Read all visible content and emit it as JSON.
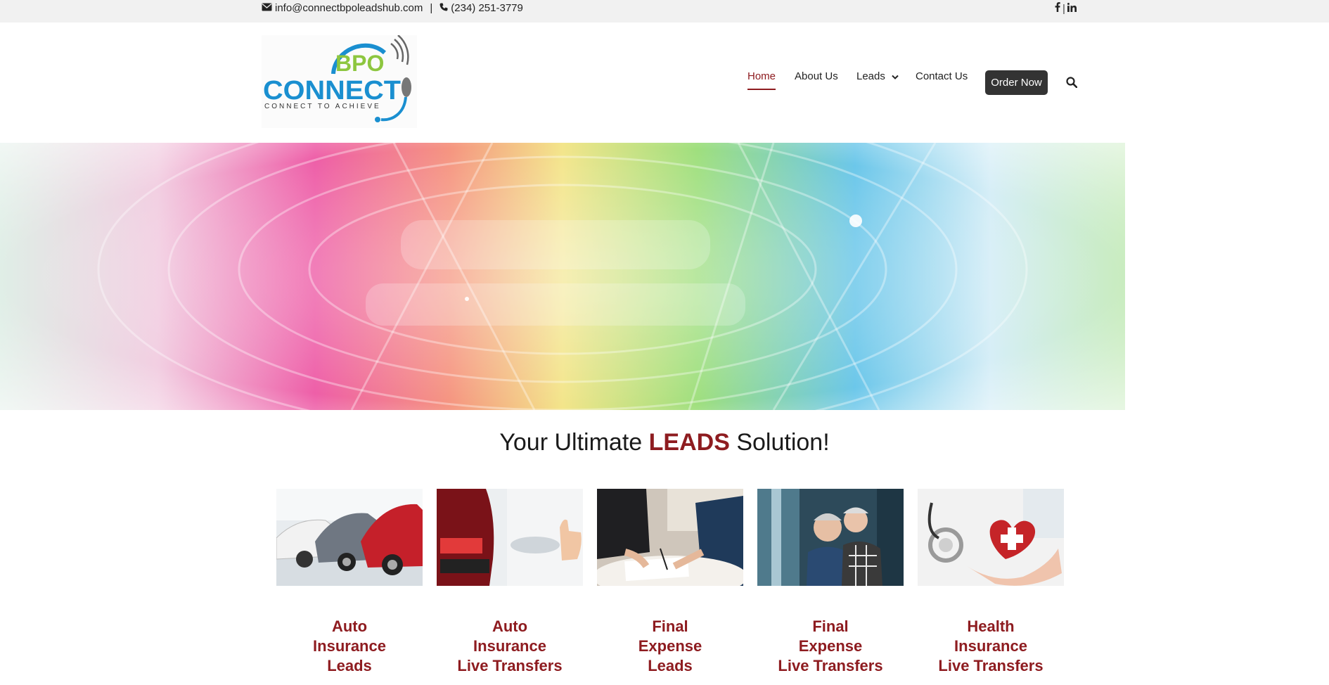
{
  "topbar": {
    "email": "info@connectbpoleadshub.com",
    "separator": "|",
    "phone": "(234) 251-3779",
    "social_sep": "|"
  },
  "logo": {
    "word_top": "BPO",
    "word_main": "CONNECT",
    "tagline": "CONNECT TO ACHIEVE"
  },
  "nav": {
    "items": [
      "Home",
      "About Us",
      "Leads",
      "Contact Us"
    ],
    "order_label": "Order Now"
  },
  "headline": {
    "prefix": "Your Ultimate ",
    "highlight": "LEADS",
    "suffix": " Solution!"
  },
  "cards": [
    {
      "lines": [
        "Auto",
        "Insurance",
        "Leads"
      ]
    },
    {
      "lines": [
        "Auto",
        "Insurance",
        "Live Transfers"
      ]
    },
    {
      "lines": [
        "Final",
        "Expense",
        "Leads"
      ]
    },
    {
      "lines": [
        "Final",
        "Expense",
        "Live Transfers"
      ]
    },
    {
      "lines": [
        "Health",
        "Insurance",
        "Live Transfers"
      ]
    }
  ],
  "colors": {
    "accent": "#8e1c20",
    "topbar_bg": "#f1f1f1",
    "button_bg": "#333333",
    "logo_blue": "#1a8fd0",
    "logo_green": "#8dc63f"
  }
}
